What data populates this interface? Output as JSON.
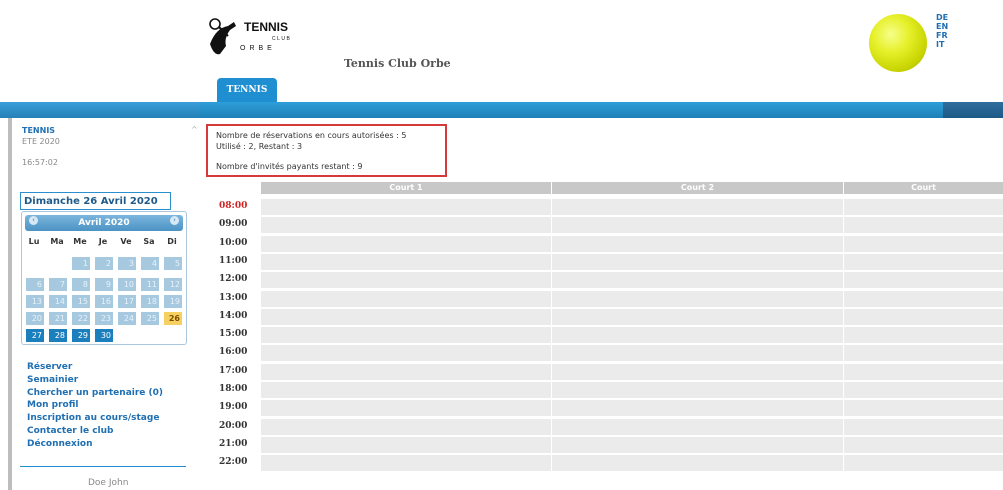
{
  "header": {
    "club_name": "Tennis Club Orbe",
    "logo_text": "TENNIS CLUB ORBE",
    "languages": [
      "DE",
      "EN",
      "FR",
      "IT"
    ],
    "tab": "TENNIS"
  },
  "sidebar": {
    "sport": "TENNIS",
    "season": "ETE 2020",
    "clock": "16:57:02",
    "selected_date": "Dimanche 26 Avril 2020",
    "calendar": {
      "month_label": "Avril 2020",
      "weekdays": [
        "Lu",
        "Ma",
        "Me",
        "Je",
        "Ve",
        "Sa",
        "Di"
      ],
      "days": [
        "1",
        "2",
        "3",
        "4",
        "5",
        "6",
        "7",
        "8",
        "9",
        "10",
        "11",
        "12",
        "13",
        "14",
        "15",
        "16",
        "17",
        "18",
        "19",
        "20",
        "21",
        "22",
        "23",
        "24",
        "25",
        "26",
        "27",
        "28",
        "29",
        "30"
      ],
      "first_weekday_index": 2,
      "today": "26"
    },
    "nav": [
      "Réserver",
      "Semainier",
      "Chercher un partenaire (0)",
      "Mon profil",
      "Inscription au cours/stage",
      "Contacter le club",
      "Déconnexion"
    ],
    "user": "Doe John"
  },
  "info": {
    "line1": "Nombre de réservations en cours autorisées : 5",
    "line2": "Utilisé : 2, Restant : 3",
    "line3": "Nombre d'invités payants restant : 9"
  },
  "schedule": {
    "courts": [
      "Court 1",
      "Court 2",
      "Court"
    ],
    "times": [
      "08:00",
      "09:00",
      "10:00",
      "11:00",
      "12:00",
      "13:00",
      "14:00",
      "15:00",
      "16:00",
      "17:00",
      "18:00",
      "19:00",
      "20:00",
      "21:00",
      "22:00"
    ],
    "current_time": "08:00"
  },
  "colors": {
    "accent": "#1f8fd1",
    "link": "#1f6fb2",
    "highlight_border": "#d43a3a",
    "current_time": "#d42222",
    "today": "#f6d060"
  }
}
